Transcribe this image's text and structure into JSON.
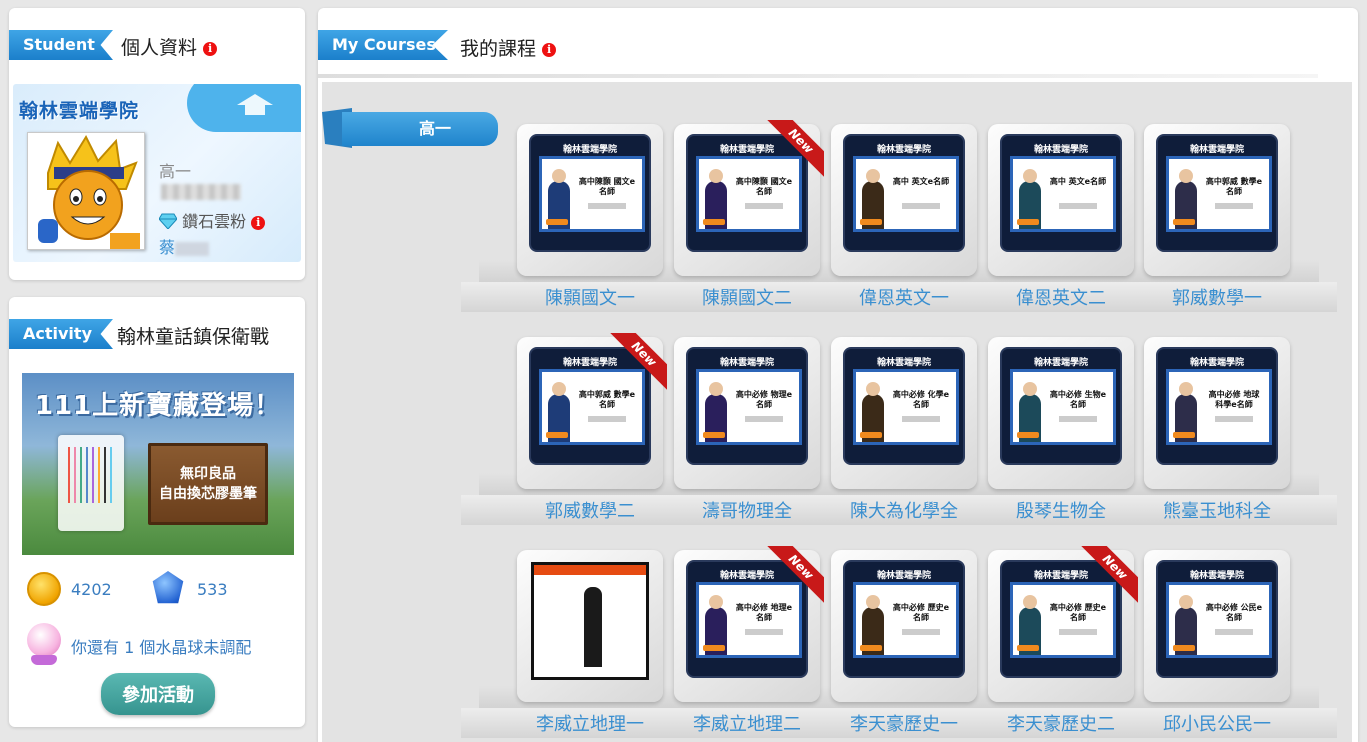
{
  "student": {
    "ribbon": "Student",
    "title": "個人資料",
    "brand": "翰林雲端學院",
    "grade": "高一",
    "level": "鑽石雲粉",
    "name_prefix": "蔡"
  },
  "activity": {
    "ribbon": "Activity",
    "title": "翰林童話鎮保衛戰",
    "banner_title": "111上新寶藏登場！",
    "banner_sign_line1": "無印良品",
    "banner_sign_line2": "自由換芯膠墨筆",
    "coins": "4202",
    "gems": "533",
    "crystal_text": "你還有 1 個水晶球未調配",
    "join_button": "參加活動"
  },
  "courses": {
    "ribbon": "My Courses",
    "title": "我的課程",
    "grade_tab": "高一",
    "tile_logo": "翰林雲端學院",
    "new_badge": "New",
    "rows": [
      [
        {
          "label": "陳顥國文一",
          "poster": "高中陳顥 國文e名師",
          "new": false
        },
        {
          "label": "陳顥國文二",
          "poster": "高中陳顥 國文e名師",
          "new": true
        },
        {
          "label": "偉恩英文一",
          "poster": "高中 英文e名師",
          "new": false
        },
        {
          "label": "偉恩英文二",
          "poster": "高中 英文e名師",
          "new": false
        },
        {
          "label": "郭威數學一",
          "poster": "高中郭威 數學e名師",
          "new": false
        }
      ],
      [
        {
          "label": "郭威數學二",
          "poster": "高中郭威 數學e名師",
          "new": true
        },
        {
          "label": "濤哥物理全",
          "poster": "高中必修 物理e名師",
          "new": false
        },
        {
          "label": "陳大為化學全",
          "poster": "高中必修 化學e名師",
          "new": false
        },
        {
          "label": "殷琴生物全",
          "poster": "高中必修 生物e名師",
          "new": false
        },
        {
          "label": "熊臺玉地科全",
          "poster": "高中必修 地球科學e名師",
          "new": false
        }
      ],
      [
        {
          "label": "李威立地理一",
          "poster": "",
          "new": false
        },
        {
          "label": "李威立地理二",
          "poster": "高中必修 地理e名師",
          "new": true
        },
        {
          "label": "李天豪歷史一",
          "poster": "高中必修 歷史e名師",
          "new": false
        },
        {
          "label": "李天豪歷史二",
          "poster": "高中必修 歷史e名師",
          "new": true
        },
        {
          "label": "邱小民公民一",
          "poster": "高中必修 公民e名師",
          "new": false
        }
      ]
    ]
  },
  "colors": {
    "ribbon_blue": "#1b7fcb",
    "link_blue": "#3a8fd0",
    "new_red": "#c81919",
    "button_teal": "#36948f"
  }
}
